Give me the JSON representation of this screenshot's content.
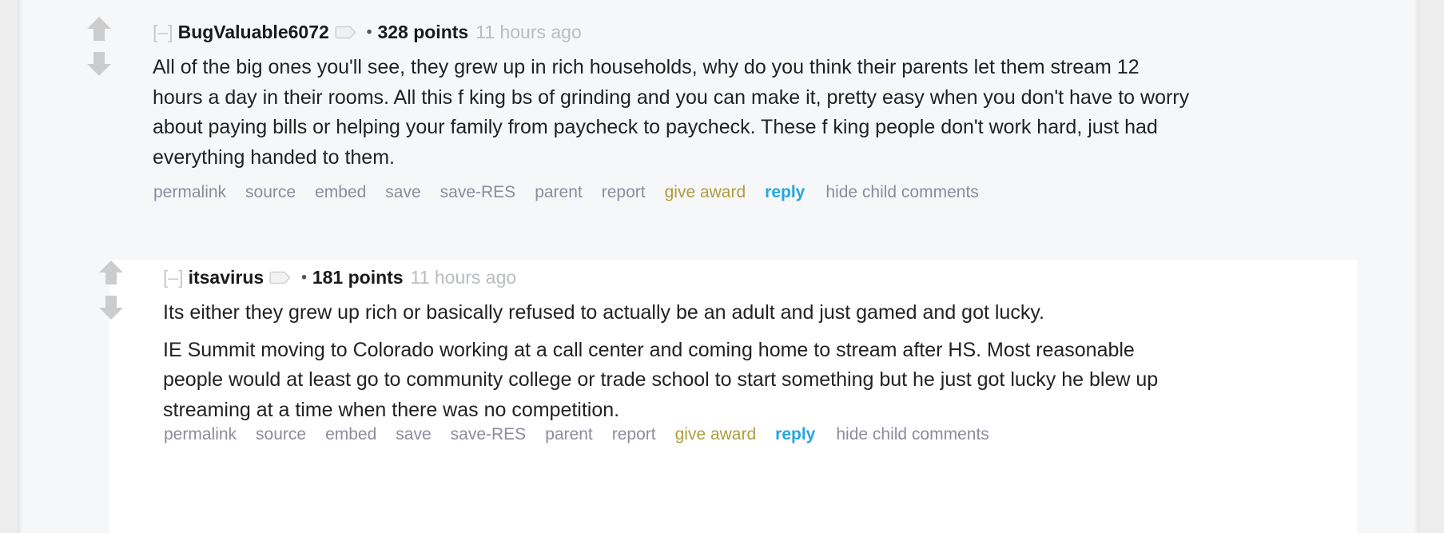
{
  "theme": {
    "page_background": "#ededed",
    "content_background": "#f6f7f8",
    "nested_background": "#ffffff",
    "body_text_color": "#222222",
    "author_color": "#1a1a1b",
    "muted_color": "#b9bcc0",
    "link_color": "#8c8c9e",
    "award_color": "#ad9c3e",
    "reply_color": "#25a5e0",
    "arrow_color": "#cccccc"
  },
  "comments": [
    {
      "id": "comment-1",
      "expand_toggle": "[–]",
      "author": "BugValuable6072",
      "usertag_icon": "tag-icon",
      "separator": "•",
      "score": "328 points",
      "timestamp": "11 hours ago",
      "upvote_icon": "upvote-arrow-icon",
      "downvote_icon": "downvote-arrow-icon",
      "paragraphs": [
        "All of the big ones you'll see, they grew up in rich households, why do you think their parents let them stream 12 hours a day in their rooms. All this f   king bs of grinding and you can make it, pretty easy when you don't have to worry about paying bills or helping your family from paycheck to paycheck. These f   king people don't work hard, just had everything handed to them."
      ],
      "actions": [
        {
          "label": "permalink",
          "style": "default"
        },
        {
          "label": "source",
          "style": "default"
        },
        {
          "label": "embed",
          "style": "default"
        },
        {
          "label": "save",
          "style": "default"
        },
        {
          "label": "save-RES",
          "style": "default"
        },
        {
          "label": "parent",
          "style": "default"
        },
        {
          "label": "report",
          "style": "default"
        },
        {
          "label": "give award",
          "style": "award"
        },
        {
          "label": "reply",
          "style": "reply"
        },
        {
          "label": "hide child comments",
          "style": "default"
        }
      ]
    },
    {
      "id": "comment-2",
      "expand_toggle": "[–]",
      "author": "itsavirus",
      "usertag_icon": "tag-icon",
      "separator": "•",
      "score": "181 points",
      "timestamp": "11 hours ago",
      "upvote_icon": "upvote-arrow-icon",
      "downvote_icon": "downvote-arrow-icon",
      "paragraphs": [
        "Its either they grew up rich or basically refused to actually be an adult and just gamed and got lucky.",
        "IE Summit moving to Colorado working at a call center and coming home to stream after HS. Most reasonable people would at least go to community college or trade school to start something but he just got lucky he blew up streaming at a time when there was no competition."
      ],
      "actions": [
        {
          "label": "permalink",
          "style": "default"
        },
        {
          "label": "source",
          "style": "default"
        },
        {
          "label": "embed",
          "style": "default"
        },
        {
          "label": "save",
          "style": "default"
        },
        {
          "label": "save-RES",
          "style": "default"
        },
        {
          "label": "parent",
          "style": "default"
        },
        {
          "label": "report",
          "style": "default"
        },
        {
          "label": "give award",
          "style": "award"
        },
        {
          "label": "reply",
          "style": "reply"
        },
        {
          "label": "hide child comments",
          "style": "default"
        }
      ]
    }
  ]
}
